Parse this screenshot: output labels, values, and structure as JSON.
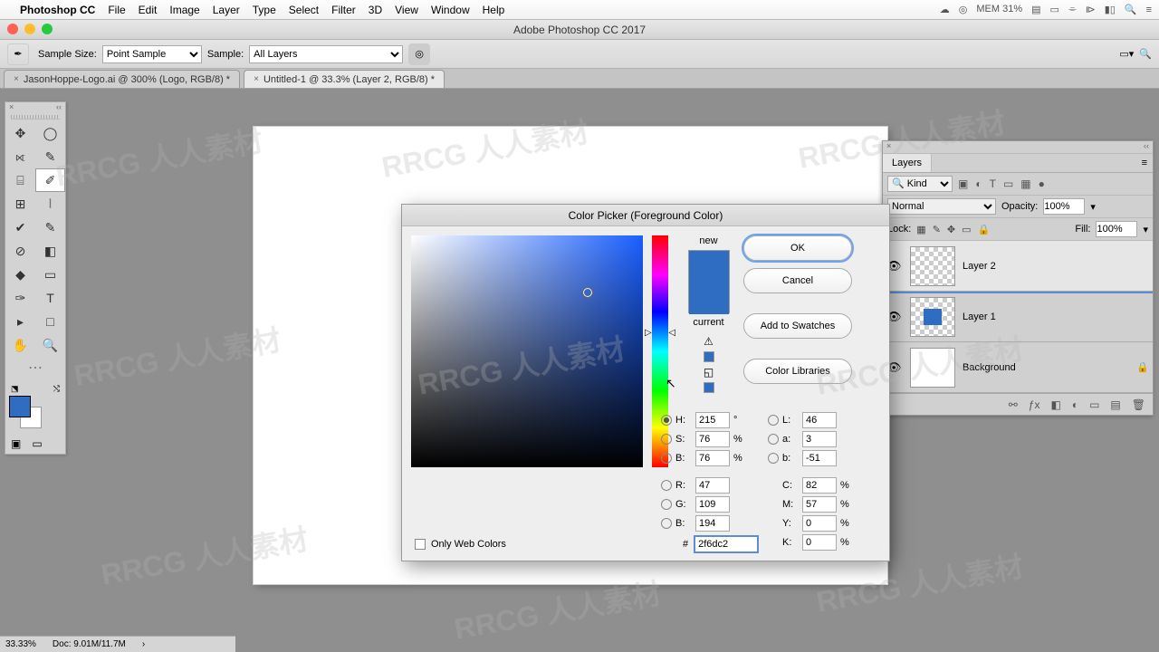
{
  "menubar": {
    "app": "Photoshop CC",
    "items": [
      "File",
      "Edit",
      "Image",
      "Layer",
      "Type",
      "Select",
      "Filter",
      "3D",
      "View",
      "Window",
      "Help"
    ],
    "mem": "MEM\n31%"
  },
  "window": {
    "title": "Adobe Photoshop CC 2017"
  },
  "options": {
    "sample_size_label": "Sample Size:",
    "sample_size_value": "Point Sample",
    "sample_label": "Sample:",
    "sample_value": "All Layers"
  },
  "tabs": [
    {
      "label": "JasonHoppe-Logo.ai @ 300% (Logo, RGB/8) *",
      "active": false
    },
    {
      "label": "Untitled-1 @ 33.3% (Layer 2, RGB/8) *",
      "active": true
    }
  ],
  "tools": [
    "✥",
    "◯",
    "⟖",
    "✎",
    "⌸",
    "✐",
    "⊞",
    "⦚",
    "✔",
    "✎",
    "⊘",
    "◧",
    "◆",
    "▭",
    "✑",
    "T",
    "▸",
    "□",
    "✋",
    "🔍"
  ],
  "color_swatch": {
    "fg": "#2f6dc2",
    "bg": "#ffffff"
  },
  "layers_panel": {
    "title": "Layers",
    "filter_kind": "Kind",
    "blend_mode": "Normal",
    "opacity_label": "Opacity:",
    "opacity_value": "100%",
    "lock_label": "Lock:",
    "fill_label": "Fill:",
    "fill_value": "100%",
    "layers": [
      {
        "name": "Layer 2",
        "selected": true,
        "thumb": "checker"
      },
      {
        "name": "Layer 1",
        "selected": false,
        "thumb": "filled"
      },
      {
        "name": "Background",
        "selected": false,
        "thumb": "white",
        "locked": true
      }
    ]
  },
  "color_picker": {
    "title": "Color Picker (Foreground Color)",
    "new_label": "new",
    "current_label": "current",
    "ok": "OK",
    "cancel": "Cancel",
    "add_swatches": "Add to Swatches",
    "color_libraries": "Color Libraries",
    "only_web": "Only Web Colors",
    "H": "215",
    "S": "76",
    "B": "76",
    "R": "47",
    "G": "109",
    "Bv": "194",
    "L": "46",
    "a": "3",
    "bv": "-51",
    "C": "82",
    "M": "57",
    "Y": "0",
    "K": "0",
    "hex": "2f6dc2"
  },
  "status": {
    "zoom": "33.33%",
    "doc": "Doc: 9.01M/11.7M"
  },
  "watermark": "RRCG 人人素材"
}
